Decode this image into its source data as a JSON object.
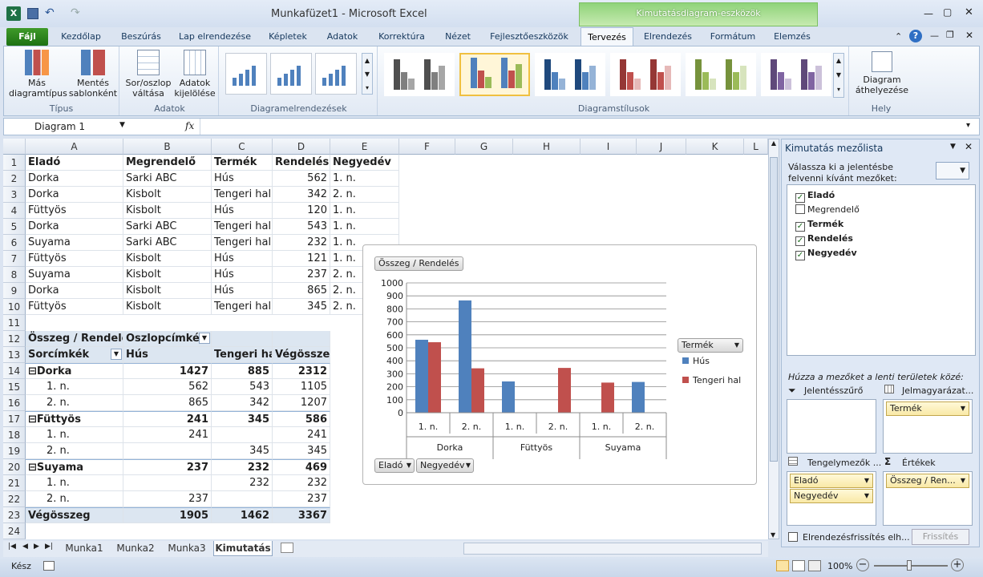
{
  "window": {
    "title": "Munkafüzet1 - Microsoft Excel",
    "context_tab": "Kimutatásdiagram-eszközök"
  },
  "tabs": [
    "Fájl",
    "Kezdőlap",
    "Beszúrás",
    "Lap elrendezése",
    "Képletek",
    "Adatok",
    "Korrektúra",
    "Nézet",
    "Fejlesztőeszközök",
    "Tervezés",
    "Elrendezés",
    "Formátum",
    "Elemzés"
  ],
  "ribbon": {
    "tipus": {
      "label": "Típus",
      "b1": "Más",
      "b1b": "diagramtípus",
      "b2": "Mentés",
      "b2b": "sablonként"
    },
    "adatok": {
      "label": "Adatok",
      "b1": "Sor/oszlop",
      "b1b": "váltása",
      "b2": "Adatok",
      "b2b": "kijelölése"
    },
    "layouts": {
      "label": "Diagramelrendezések"
    },
    "styles": {
      "label": "Diagramstílusok",
      "colors": [
        [
          "#4f4f4f",
          "#7f7f7f",
          "#a6a6a6"
        ],
        [
          "#4f81bd",
          "#c0504d",
          "#9bbb59"
        ],
        [
          "#1f497d",
          "#4f81bd",
          "#95b3d7"
        ],
        [
          "#953735",
          "#c0504d",
          "#e6b9b8"
        ],
        [
          "#76923c",
          "#9bbb59",
          "#d7e4bd"
        ],
        [
          "#5f497a",
          "#8064a2",
          "#ccc1da"
        ]
      ]
    },
    "hely": {
      "label": "Hely",
      "b1": "Diagram",
      "b1b": "áthelyezése"
    }
  },
  "formula": {
    "namebox": "Diagram 1",
    "fx": "fx"
  },
  "columns": [
    "A",
    "B",
    "C",
    "D",
    "E",
    "F",
    "G",
    "H",
    "I",
    "J",
    "K",
    "L"
  ],
  "rows": [
    [
      "Eladó",
      "Megrendelő",
      "Termék",
      "Rendelés",
      "Negyedév"
    ],
    [
      "Dorka",
      "Sarki ABC",
      "Hús",
      "562",
      "1. n."
    ],
    [
      "Dorka",
      "Kisbolt",
      "Tengeri hal",
      "342",
      "2. n."
    ],
    [
      "Füttyös",
      "Kisbolt",
      "Hús",
      "120",
      "1. n."
    ],
    [
      "Dorka",
      "Sarki ABC",
      "Tengeri hal",
      "543",
      "1. n."
    ],
    [
      "Suyama",
      "Sarki ABC",
      "Tengeri hal",
      "232",
      "1. n."
    ],
    [
      "Füttyös",
      "Kisbolt",
      "Hús",
      "121",
      "1. n."
    ],
    [
      "Suyama",
      "Kisbolt",
      "Hús",
      "237",
      "2. n."
    ],
    [
      "Dorka",
      "Kisbolt",
      "Hús",
      "865",
      "2. n."
    ],
    [
      "Füttyös",
      "Kisbolt",
      "Tengeri hal",
      "345",
      "2. n."
    ]
  ],
  "pivot": {
    "corner": "Összeg / Rendelés",
    "collabel": "Oszlopcímkék",
    "rowlabel": "Sorcímkék",
    "h1": "Hús",
    "h2": "Tengeri hal",
    "h3": "Végösszeg",
    "rows": [
      [
        "⊟Dorka",
        "1427",
        "885",
        "2312"
      ],
      [
        "1. n.",
        "562",
        "543",
        "1105"
      ],
      [
        "2. n.",
        "865",
        "342",
        "1207"
      ],
      [
        "⊟Füttyös",
        "241",
        "345",
        "586"
      ],
      [
        "1. n.",
        "241",
        "",
        "241"
      ],
      [
        "2. n.",
        "",
        "345",
        "345"
      ],
      [
        "⊟Suyama",
        "237",
        "232",
        "469"
      ],
      [
        "1. n.",
        "",
        "232",
        "232"
      ],
      [
        "2. n.",
        "237",
        "",
        "237"
      ],
      [
        "Végösszeg",
        "1905",
        "1462",
        "3367"
      ]
    ]
  },
  "chart_data": {
    "type": "bar",
    "title_button": "Összeg / Rendelés",
    "legend_button": "Termék",
    "axis_buttons": [
      "Eladó",
      "Negyedév"
    ],
    "groups": [
      "Dorka",
      "Füttyös",
      "Suyama"
    ],
    "categories": [
      "1. n.",
      "2. n.",
      "1. n.",
      "2. n.",
      "1. n.",
      "2. n."
    ],
    "series": [
      {
        "name": "Hús",
        "color": "#4f81bd",
        "values": [
          562,
          865,
          241,
          0,
          0,
          237
        ]
      },
      {
        "name": "Tengeri hal",
        "color": "#c0504d",
        "values": [
          543,
          342,
          0,
          345,
          232,
          0
        ]
      }
    ],
    "yticks": [
      "1000",
      "900",
      "800",
      "700",
      "600",
      "500",
      "400",
      "300",
      "200",
      "100",
      "0"
    ],
    "ylim": [
      0,
      1000
    ],
    "legend": "right"
  },
  "pane": {
    "title": "Kimutatás mezőlista",
    "instr": "Válassza ki a jelentésbe felvenni kívánt mezőket:",
    "fields": [
      {
        "name": "Eladó",
        "checked": true
      },
      {
        "name": "Megrendelő",
        "checked": false
      },
      {
        "name": "Termék",
        "checked": true
      },
      {
        "name": "Rendelés",
        "checked": true
      },
      {
        "name": "Negyedév",
        "checked": true
      }
    ],
    "drag": "Húzza a mezőket a lenti területek közé:",
    "z1": "Jelentésszűrő",
    "z2": "Jelmagyarázat...",
    "z3": "Tengelymezők ...",
    "z4": "Értékek",
    "z2items": [
      "Termék"
    ],
    "z3items": [
      "Eladó",
      "Negyedév"
    ],
    "z4items": [
      "Összeg / Ren..."
    ],
    "defer": "Elrendezésfrissítés elh...",
    "update": "Frissítés"
  },
  "sheets": [
    "Munka1",
    "Munka2",
    "Munka3",
    "Kimutatás"
  ],
  "status": {
    "ready": "Kész",
    "zoom": "100%"
  }
}
